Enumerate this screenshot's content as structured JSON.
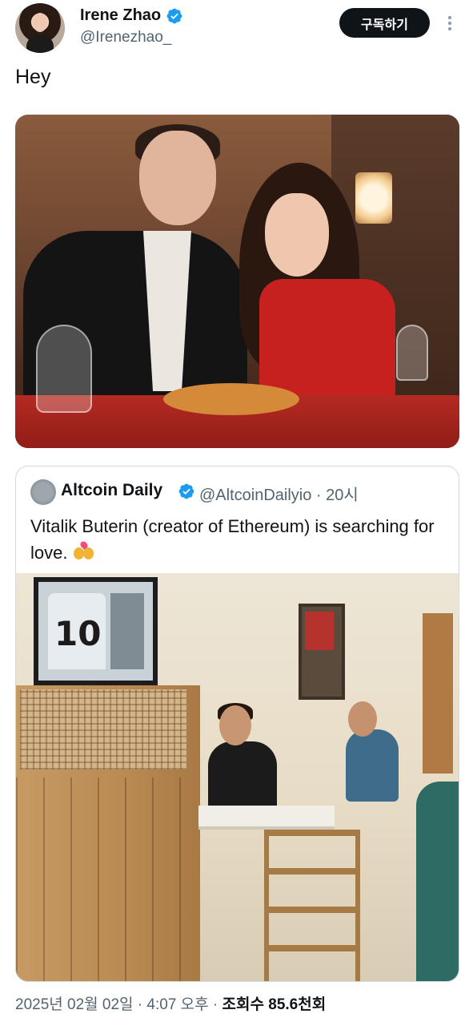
{
  "author": {
    "display_name": "Irene Zhao",
    "handle": "@Irenezhao_",
    "verified": true
  },
  "subscribe_label": "구독하기",
  "tweet_text": "Hey",
  "quote": {
    "display_name": "Altcoin Daily",
    "handle_time": "@AltcoinDailyio · 20시",
    "verified": true,
    "text": "Vitalik Buterin (creator of Ethereum) is searching for love."
  },
  "meta": {
    "timestamp": "2025년 02월 02일 · 4:07 오후 · ",
    "views_label": "조회수 ",
    "views_count": "85.6천회"
  },
  "colors": {
    "verified": "#1d9bf0",
    "text_primary": "#0f1419",
    "text_secondary": "#536471",
    "border": "#cfd9de"
  },
  "icons": [
    "verified-badge-icon",
    "more-icon",
    "kiss-emoji-icon"
  ]
}
